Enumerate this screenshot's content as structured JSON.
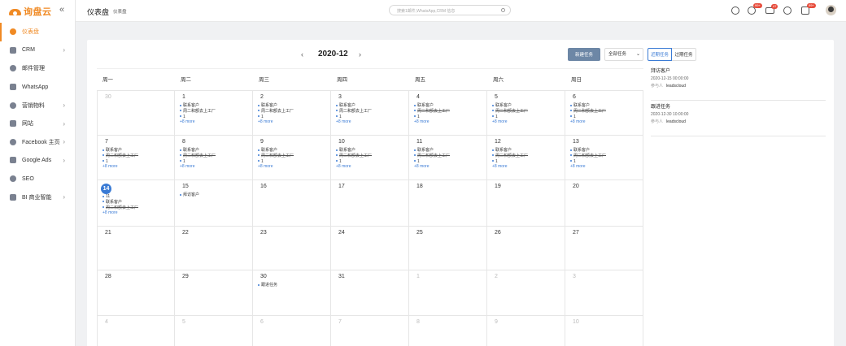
{
  "app": {
    "logo_text": "询盘云",
    "collapse": "«"
  },
  "sidebar": {
    "items": [
      {
        "label": "仪表盘",
        "arrow": ""
      },
      {
        "label": "CRM",
        "arrow": "›"
      },
      {
        "label": "邮件管理",
        "arrow": ""
      },
      {
        "label": "WhatsApp",
        "arrow": ""
      },
      {
        "label": "营销物料",
        "arrow": "›"
      },
      {
        "label": "网站",
        "arrow": "›"
      },
      {
        "label": "Facebook 主页",
        "arrow": "›"
      },
      {
        "label": "Google Ads",
        "arrow": "›"
      },
      {
        "label": "SEO",
        "arrow": ""
      },
      {
        "label": "BI 商业智能",
        "arrow": "›"
      }
    ]
  },
  "header": {
    "title": "仪表盘",
    "breadcrumb": "仪表盘",
    "search_placeholder": "搜索1邮件,WhatsApp,CRM 信息",
    "badges": [
      "99+",
      "47",
      "99+"
    ]
  },
  "calendar": {
    "prev": "‹",
    "next": "›",
    "month": "2020-12",
    "new_task": "新建任务",
    "filter": "全部任务",
    "filter_arrow": "⌄",
    "tab_recent": "近期任务",
    "tab_expired": "过期任务",
    "weekdays": [
      "周一",
      "周二",
      "周三",
      "周四",
      "周五",
      "周六",
      "周日"
    ],
    "weeks": [
      {
        "h": 55,
        "days": [
          {
            "d": "30",
            "dim": true,
            "ev": []
          },
          {
            "d": "1",
            "ev": [
              {
                "t": "联系客户"
              },
              {
                "t": "周二和额去上工厂"
              },
              {
                "t": "1"
              }
            ],
            "more": "+8 more"
          },
          {
            "d": "2",
            "ev": [
              {
                "t": "联系客户"
              },
              {
                "t": "周二和额去上工厂"
              },
              {
                "t": "1"
              }
            ],
            "more": "+8 more"
          },
          {
            "d": "3",
            "ev": [
              {
                "t": "联系客户"
              },
              {
                "t": "周二和额去上工厂"
              },
              {
                "t": "1"
              }
            ],
            "more": "+8 more"
          },
          {
            "d": "4",
            "ev": [
              {
                "t": "联系客户"
              },
              {
                "t": "周二和额去上工厂",
                "s": true
              },
              {
                "t": "1"
              }
            ],
            "more": "+8 more"
          },
          {
            "d": "5",
            "ev": [
              {
                "t": "联系客户"
              },
              {
                "t": "周二和额去上工厂",
                "s": true
              },
              {
                "t": "1"
              }
            ],
            "more": "+8 more"
          },
          {
            "d": "6",
            "ev": [
              {
                "t": "联系客户"
              },
              {
                "t": "周二和额去上工厂",
                "s": true
              },
              {
                "t": "1"
              }
            ],
            "more": "+8 more"
          }
        ]
      },
      {
        "h": 55,
        "days": [
          {
            "d": "7",
            "ev": [
              {
                "t": "联系客户"
              },
              {
                "t": "周二和额去上工厂",
                "s": true
              },
              {
                "t": "1"
              }
            ],
            "more": "+8 more"
          },
          {
            "d": "8",
            "ev": [
              {
                "t": "联系客户"
              },
              {
                "t": "周二和额去上工厂",
                "s": true
              },
              {
                "t": "1"
              }
            ],
            "more": "+8 more"
          },
          {
            "d": "9",
            "ev": [
              {
                "t": "联系客户"
              },
              {
                "t": "周二和额去上工厂",
                "s": true
              },
              {
                "t": "1"
              }
            ],
            "more": "+8 more"
          },
          {
            "d": "10",
            "ev": [
              {
                "t": "联系客户"
              },
              {
                "t": "周二和额去上工厂",
                "s": true
              },
              {
                "t": "1"
              }
            ],
            "more": "+8 more"
          },
          {
            "d": "11",
            "ev": [
              {
                "t": "联系客户"
              },
              {
                "t": "周二和额去上工厂",
                "s": true
              },
              {
                "t": "1"
              }
            ],
            "more": "+8 more"
          },
          {
            "d": "12",
            "ev": [
              {
                "t": "联系客户"
              },
              {
                "t": "周二和额去上工厂",
                "s": true
              },
              {
                "t": "1"
              }
            ],
            "more": "+8 more"
          },
          {
            "d": "13",
            "ev": [
              {
                "t": "联系客户"
              },
              {
                "t": "周二和额去上工厂",
                "s": true
              },
              {
                "t": "1"
              }
            ],
            "more": "+8 more"
          }
        ]
      },
      {
        "h": 57,
        "days": [
          {
            "d": "14",
            "today": true,
            "ev": [
              {
                "t": "11"
              },
              {
                "t": "联系客户"
              },
              {
                "t": "周二和额去上工厂",
                "s": true
              }
            ],
            "more": "+8 more"
          },
          {
            "d": "15",
            "ev": [
              {
                "t": "拜访客户"
              }
            ]
          },
          {
            "d": "16",
            "ev": []
          },
          {
            "d": "17",
            "ev": []
          },
          {
            "d": "18",
            "ev": []
          },
          {
            "d": "19",
            "ev": []
          },
          {
            "d": "20",
            "ev": []
          }
        ]
      },
      {
        "h": 54,
        "days": [
          {
            "d": "21",
            "ev": []
          },
          {
            "d": "22",
            "ev": []
          },
          {
            "d": "23",
            "ev": []
          },
          {
            "d": "24",
            "ev": []
          },
          {
            "d": "25",
            "ev": []
          },
          {
            "d": "26",
            "ev": []
          },
          {
            "d": "27",
            "ev": []
          }
        ]
      },
      {
        "h": 56,
        "days": [
          {
            "d": "28",
            "ev": []
          },
          {
            "d": "29",
            "ev": []
          },
          {
            "d": "30",
            "ev": [
              {
                "t": "跟进任务"
              }
            ]
          },
          {
            "d": "31",
            "ev": []
          },
          {
            "d": "1",
            "dim": true,
            "ev": []
          },
          {
            "d": "2",
            "dim": true,
            "ev": []
          },
          {
            "d": "3",
            "dim": true,
            "ev": []
          }
        ]
      },
      {
        "h": 40,
        "days": [
          {
            "d": "4",
            "dim": true,
            "ev": []
          },
          {
            "d": "5",
            "dim": true,
            "ev": []
          },
          {
            "d": "6",
            "dim": true,
            "ev": []
          },
          {
            "d": "7",
            "dim": true,
            "ev": []
          },
          {
            "d": "8",
            "dim": true,
            "ev": []
          },
          {
            "d": "9",
            "dim": true,
            "ev": []
          },
          {
            "d": "10",
            "dim": true,
            "ev": []
          }
        ]
      }
    ]
  },
  "tasks": {
    "participant_label": "参与人",
    "items": [
      {
        "title": "拜访客户",
        "time": "2020-12-15 00:00:00",
        "participant": "leadscloud"
      },
      {
        "title": "跟进任务",
        "time": "2020-12-30 10:00:00",
        "participant": "leadscloud"
      }
    ]
  },
  "colors": {
    "accent": "#f08a24",
    "primary": "#3a7bd5",
    "button": "#6d87a6"
  }
}
